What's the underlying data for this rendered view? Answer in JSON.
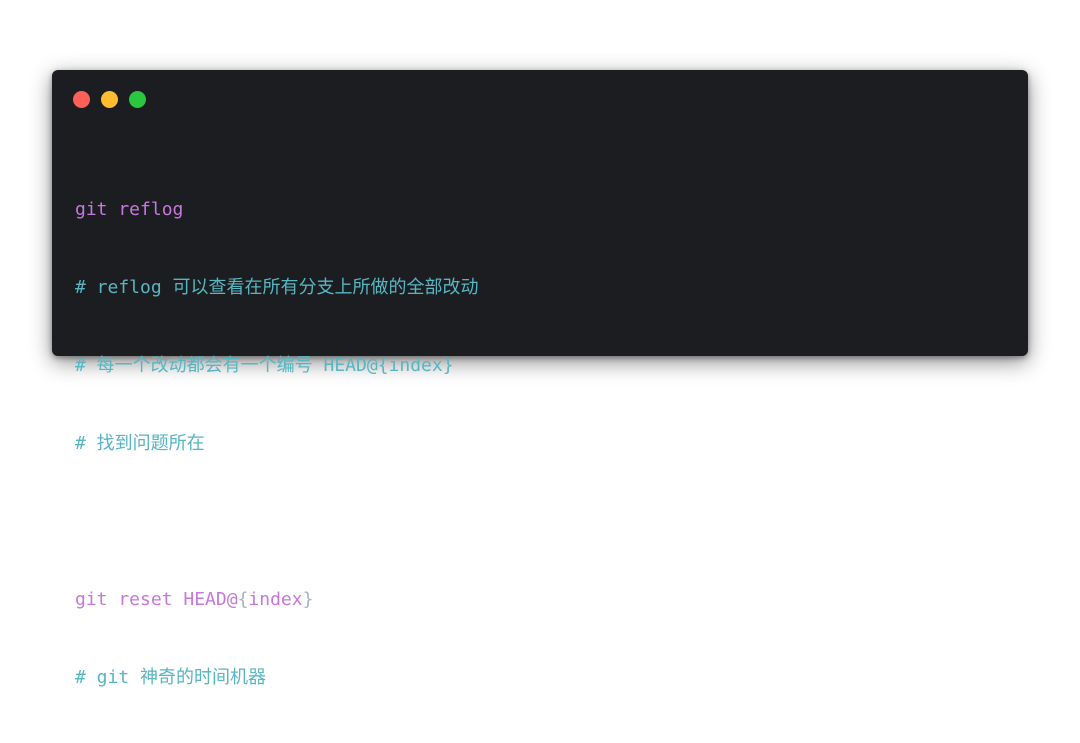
{
  "window_controls": {
    "close_color": "#ff5f57",
    "minimize_color": "#febc2e",
    "zoom_color": "#28c840"
  },
  "code": {
    "line1": "git reflog",
    "line2": "# reflog 可以查看在所有分支上所做的全部改动",
    "line3": "# 每一个改动都会有一个编号 HEAD@{index}",
    "line4": "# 找到问题所在",
    "line5": "",
    "line6_cmd": "git reset HEAD@",
    "line6_brace_open": "{",
    "line6_arg": "index",
    "line6_brace_close": "}",
    "line7": "# git 神奇的时间机器"
  },
  "colors": {
    "background": "#1c1d21",
    "command": "#c678dd",
    "comment": "#56b6c2",
    "plain": "#abb2bf"
  }
}
